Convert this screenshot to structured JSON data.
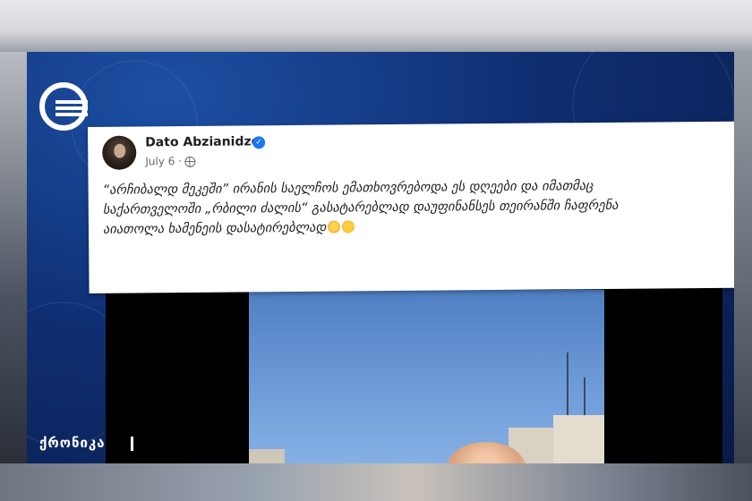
{
  "post": {
    "author": "Dato Abzianidze",
    "date": "July 6 ·",
    "text_line1": "“არჩიბალდ მეკეში” ირანის საელჩოს ემათხოვრებოდა ეს დღეები და იმათმაც",
    "text_line2": "საქართველოში „რბილი ძალის“ გასატარებლად დაუფინანსეს თეირანში ჩაფრენა",
    "text_line3": "აიათოლა ხამენეის დასატირებლად"
  },
  "broadcast": {
    "channel_label": "ქრონიკა"
  },
  "icons": [
    "channel-logo-icon",
    "verified-badge-icon",
    "globe-icon",
    "emoji-icon"
  ],
  "colors": {
    "screen_blue": "#0f2f73",
    "verified_blue": "#1877f2",
    "card_white": "#ffffff"
  }
}
